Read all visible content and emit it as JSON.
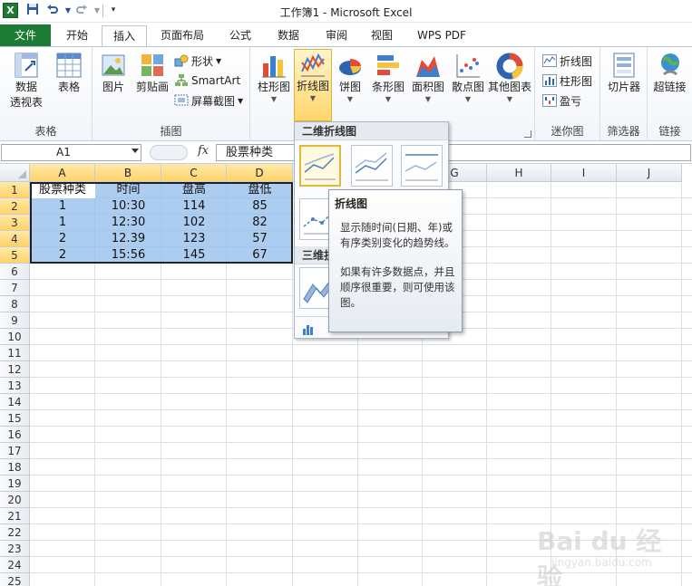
{
  "window": {
    "title": "工作簿1 - Microsoft Excel",
    "app_icon": "excel-icon",
    "quick_access": [
      "save-icon",
      "undo-icon",
      "redo-icon",
      "customize-qat-icon"
    ]
  },
  "tabs": [
    {
      "label": "文件",
      "state": "file"
    },
    {
      "label": "开始"
    },
    {
      "label": "插入",
      "state": "active"
    },
    {
      "label": "页面布局"
    },
    {
      "label": "公式"
    },
    {
      "label": "数据"
    },
    {
      "label": "审阅"
    },
    {
      "label": "视图"
    },
    {
      "label": "WPS PDF"
    }
  ],
  "ribbon": {
    "groups": [
      {
        "label": "表格",
        "buttons": [
          {
            "line1": "数据",
            "line2": "透视表"
          },
          {
            "line1": "表格"
          }
        ]
      },
      {
        "label": "插图",
        "buttons": [
          {
            "line1": "图片"
          },
          {
            "line1": "剪贴画"
          }
        ],
        "small": [
          "形状",
          "SmartArt",
          "屏幕截图"
        ]
      },
      {
        "label": "",
        "buttons": [
          {
            "line1": "柱形图"
          },
          {
            "line1": "折线图"
          },
          {
            "line1": "饼图"
          },
          {
            "line1": "条形图"
          },
          {
            "line1": "面积图"
          },
          {
            "line1": "散点图"
          },
          {
            "line1": "其他图表"
          }
        ]
      },
      {
        "label": "迷你图",
        "small": [
          "折线图",
          "柱形图",
          "盈亏"
        ]
      },
      {
        "label": "筛选器",
        "buttons": [
          {
            "line1": "切片器"
          }
        ]
      },
      {
        "label": "链接",
        "buttons": [
          {
            "line1": "超链接"
          }
        ]
      }
    ]
  },
  "formula_bar": {
    "name_box": "A1",
    "fx_label": "fx",
    "content": "股票种类"
  },
  "columns": [
    "A",
    "B",
    "C",
    "D",
    "E",
    "F",
    "G",
    "H",
    "I",
    "J"
  ],
  "rows": [
    "1",
    "2",
    "3",
    "4",
    "5",
    "6",
    "7",
    "8",
    "9",
    "10",
    "11",
    "12",
    "13",
    "14",
    "15",
    "16",
    "17",
    "18",
    "19",
    "20",
    "21",
    "22",
    "23",
    "24",
    "25"
  ],
  "table": {
    "headers": [
      "股票种类",
      "时间",
      "盘高",
      "盘低"
    ],
    "rows": [
      [
        "1",
        "10:30",
        "114",
        "85"
      ],
      [
        "1",
        "12:30",
        "102",
        "82"
      ],
      [
        "2",
        "12.39",
        "123",
        "57"
      ],
      [
        "2",
        "15:56",
        "145",
        "67"
      ]
    ]
  },
  "gallery": {
    "section_2d": "二维折线图",
    "section_3d": "三维折",
    "footer_icon": "all-chart-types-icon"
  },
  "tooltip": {
    "title": "折线图",
    "para1": "显示随时间(日期、年)或有序类别变化的趋势线。",
    "para2": "如果有许多数据点，并且顺序很重要，则可使用该图。"
  },
  "watermark": {
    "brand": "Bai du 经验",
    "url": "jingyan.baidu.com"
  },
  "colors": {
    "file_tab": "#1d7b36",
    "selection_fill": "#91bceb",
    "header_highlight": "#ffd36b"
  }
}
